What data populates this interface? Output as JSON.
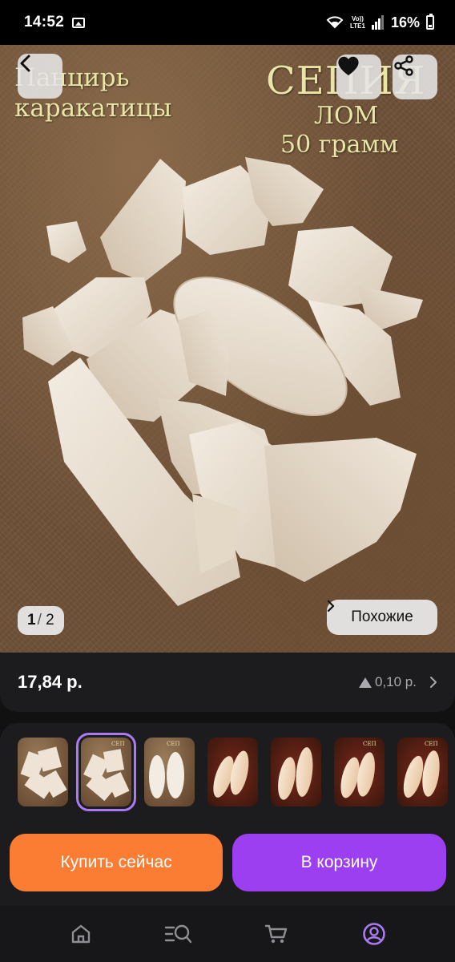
{
  "status_bar": {
    "time": "14:52",
    "network_top": "Vo))",
    "network_bottom": "LTE1",
    "battery": "16%"
  },
  "hero": {
    "text_line1": "Панцирь",
    "text_line2": "каракатицы",
    "text_brand": "СЕПИЯ",
    "text_kind": "ЛОМ",
    "text_weight": "50 грамм",
    "pager_current": "1",
    "pager_total": "2",
    "similar_label": "Похожие"
  },
  "product": {
    "price": "17,84 р.",
    "price_change": "0,10 р."
  },
  "thumbnails": [
    {
      "style": "brown",
      "selected": false
    },
    {
      "style": "brown",
      "selected": true
    },
    {
      "style": "brown-whole",
      "selected": false
    },
    {
      "style": "dark",
      "selected": false
    },
    {
      "style": "dark",
      "selected": false
    },
    {
      "style": "dark",
      "selected": false
    },
    {
      "style": "dark",
      "selected": false
    }
  ],
  "actions": {
    "buy_now": "Купить сейчас",
    "add_to_cart": "В корзину"
  },
  "colors": {
    "buy": "#fb7d34",
    "cart": "#9b3ff0",
    "selected_thumb": "#a97af0"
  },
  "nav": {
    "icons": [
      "home-icon",
      "catalog-search-icon",
      "cart-icon",
      "profile-icon"
    ],
    "active": "profile-icon"
  }
}
